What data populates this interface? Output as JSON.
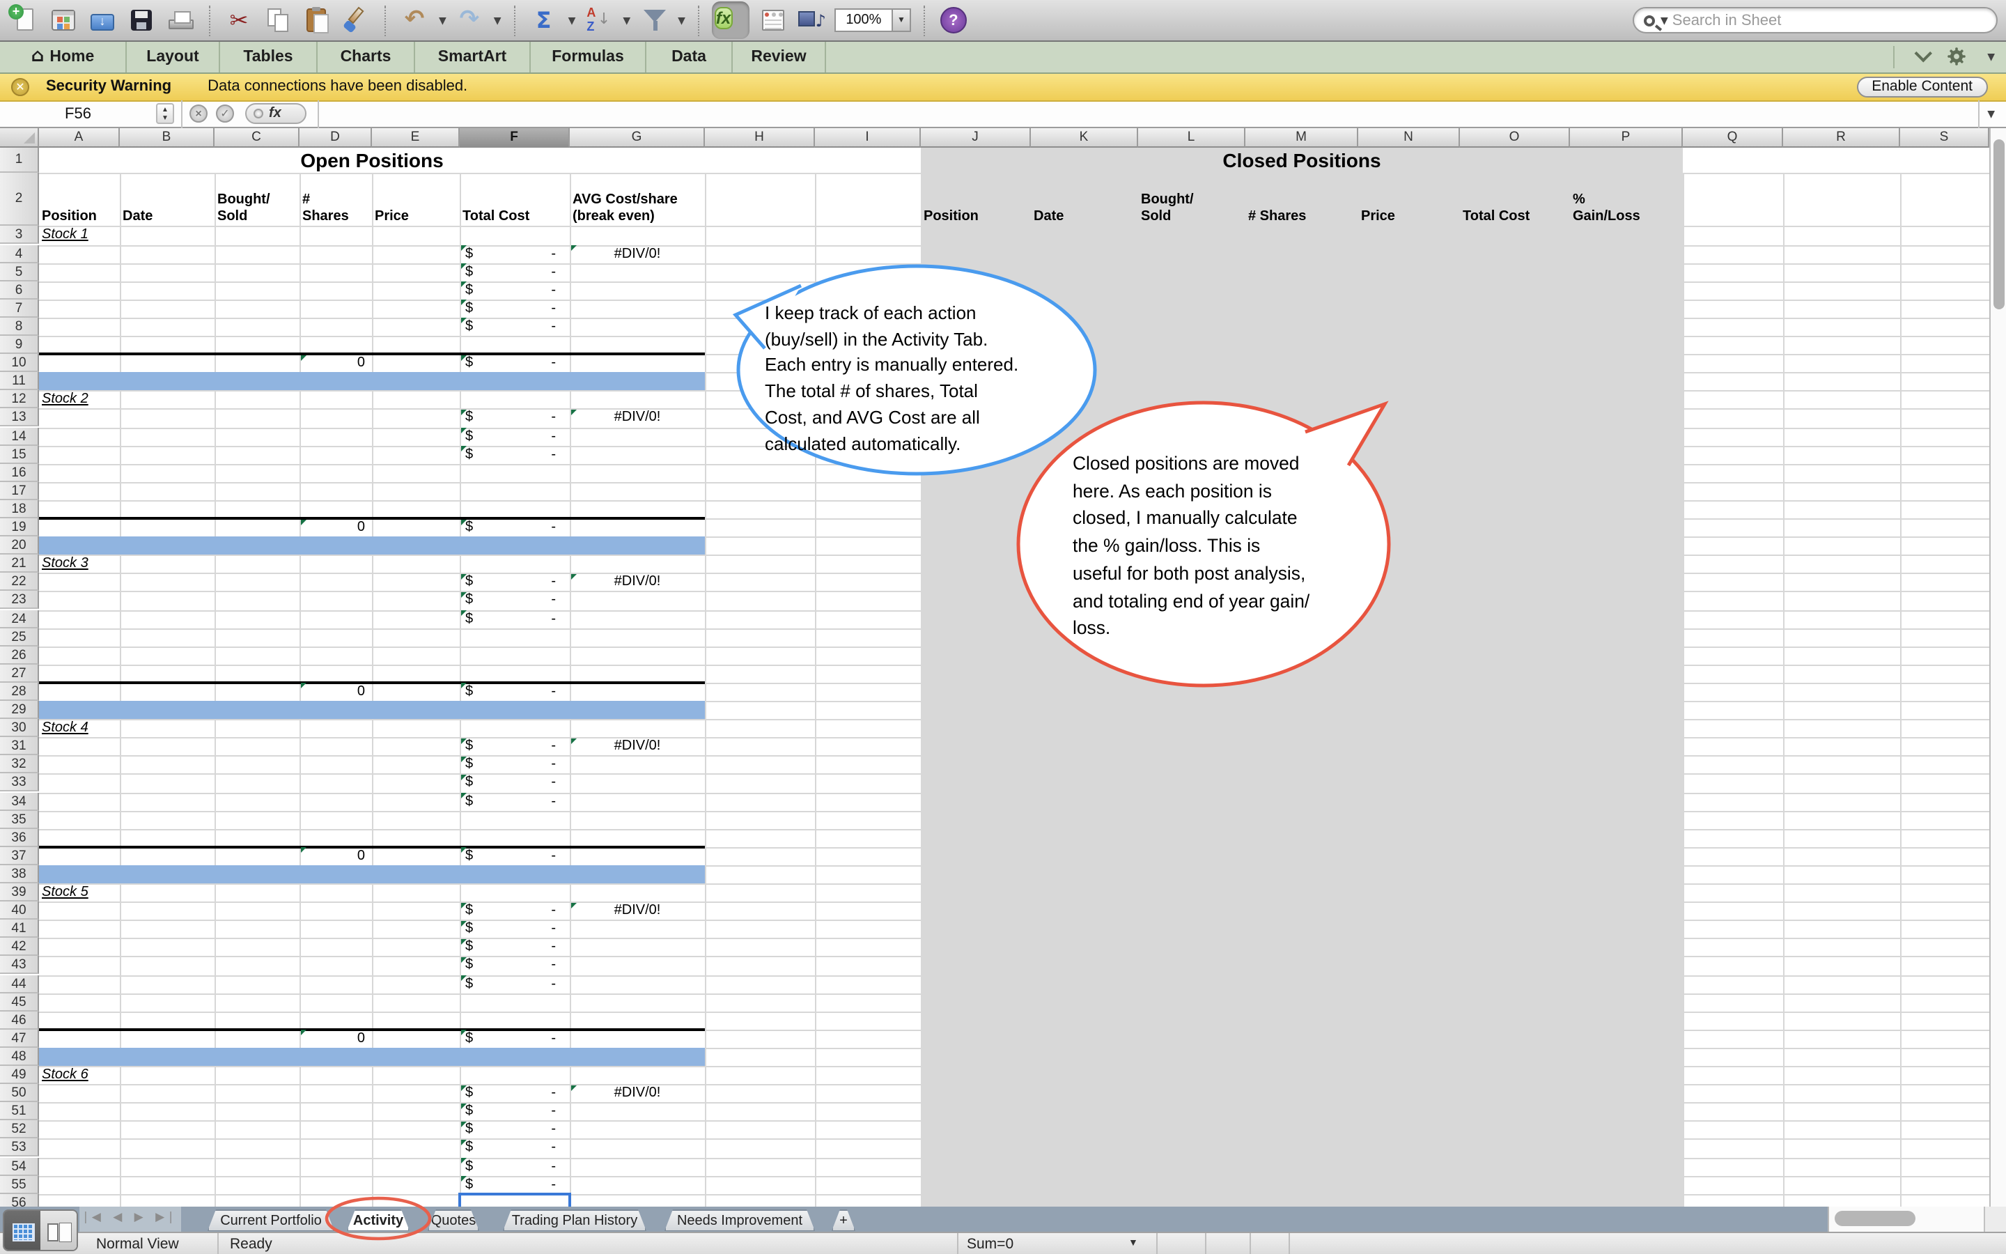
{
  "window": {
    "search_placeholder": "Search in Sheet",
    "zoom_value": "100%"
  },
  "toolbar": {
    "icon_names": [
      "new-document-icon",
      "open-gallery-icon",
      "open-file-icon",
      "save-icon",
      "print-icon",
      "cut-icon",
      "copy-icon",
      "paste-icon",
      "format-painter-icon",
      "undo-icon",
      "redo-icon",
      "autosum-icon",
      "sort-az-icon",
      "filter-icon",
      "formula-builder-icon",
      "toolbox-icon",
      "media-browser-icon",
      "zoom-control",
      "help-icon",
      "search-icon"
    ],
    "fx_label": "fx",
    "help_label": "?",
    "sum_label": "Σ",
    "sort_a": "A",
    "sort_z": "Z",
    "cut_glyph": "✂",
    "undo_glyph": "↶",
    "redo_glyph": "↷",
    "media_glyph": "♪"
  },
  "ribbon": {
    "tabs": [
      {
        "label": "Home",
        "icon": "home-icon"
      },
      {
        "label": "Layout"
      },
      {
        "label": "Tables"
      },
      {
        "label": "Charts"
      },
      {
        "label": "SmartArt"
      },
      {
        "label": "Formulas"
      },
      {
        "label": "Data"
      },
      {
        "label": "Review"
      }
    ],
    "right_icons": [
      "chevron-down-icon",
      "gear-icon"
    ]
  },
  "security_bar": {
    "title": "Security Warning",
    "message": "Data connections have been disabled.",
    "button_label": "Enable Content"
  },
  "formula_bar": {
    "name_box": "F56",
    "cancel_glyph": "×",
    "accept_glyph": "✓",
    "fx_label": "fx"
  },
  "sheet": {
    "columns": [
      "A",
      "B",
      "C",
      "D",
      "E",
      "F",
      "G",
      "H",
      "I",
      "J",
      "K",
      "L",
      "M",
      "N",
      "O",
      "P",
      "Q",
      "R",
      "S"
    ],
    "selected_column": "F",
    "selected_cell": {
      "col": "F",
      "row": 56
    },
    "row_count": 56,
    "open_table": {
      "title": "Open Positions",
      "headers": [
        {
          "col": "A",
          "text": "Position"
        },
        {
          "col": "B",
          "text": "Date"
        },
        {
          "col": "C",
          "text": "Bought/\nSold"
        },
        {
          "col": "D",
          "text": "#\nShares"
        },
        {
          "col": "E",
          "text": "Price"
        },
        {
          "col": "F",
          "text": "Total Cost"
        },
        {
          "col": "G",
          "text": "AVG Cost/share\n(break even)"
        }
      ]
    },
    "closed_table": {
      "title": "Closed Positions",
      "headers": [
        {
          "col": "J",
          "text": "Position"
        },
        {
          "col": "K",
          "text": "Date"
        },
        {
          "col": "L",
          "text": "Bought/\nSold"
        },
        {
          "col": "M",
          "text": "# Shares"
        },
        {
          "col": "N",
          "text": "Price"
        },
        {
          "col": "O",
          "text": "Total Cost"
        },
        {
          "col": "P",
          "text": "%\nGain/Loss"
        }
      ]
    },
    "cells": {
      "currency": "$",
      "dash": "-",
      "zero": "0",
      "div_error": "#DIV/0!"
    },
    "stocks": [
      {
        "label": "Stock 1",
        "label_row": 3,
        "data_start": 4,
        "data_end": 8,
        "total_row": 10,
        "band_row": 11
      },
      {
        "label": "Stock 2",
        "label_row": 12,
        "data_start": 13,
        "data_end": 15,
        "total_row": 19,
        "band_row": 20
      },
      {
        "label": "Stock 3",
        "label_row": 21,
        "data_start": 22,
        "data_end": 24,
        "total_row": 28,
        "band_row": 29
      },
      {
        "label": "Stock 4",
        "label_row": 30,
        "data_start": 31,
        "data_end": 34,
        "total_row": 37,
        "band_row": 38
      },
      {
        "label": "Stock 5",
        "label_row": 39,
        "data_start": 40,
        "data_end": 44,
        "total_row": 47,
        "band_row": 48
      },
      {
        "label": "Stock 6",
        "label_row": 49,
        "data_start": 50,
        "data_end": 55,
        "total_row": null,
        "band_row": null
      }
    ]
  },
  "callouts": {
    "blue": {
      "color": "#4a9bee",
      "text": "I keep track of each action\n(buy/sell) in the Activity Tab.\nEach entry is manually entered.\nThe total # of shares, Total\nCost, and AVG Cost are all\ncalculated automatically."
    },
    "red": {
      "color": "#e8543f",
      "text": "Closed positions are moved\nhere.  As each position is\nclosed, I manually calculate\nthe % gain/loss.  This is\nuseful for both post analysis,\nand totaling end of year gain/\nloss."
    }
  },
  "bottom": {
    "nav_arrows": "|◀ ◀ ▶ ▶|",
    "sheet_tabs": [
      {
        "label": "Current Portfolio",
        "active": false
      },
      {
        "label": "Activity",
        "active": true,
        "circled": true
      },
      {
        "label": "Quotes",
        "active": false
      },
      {
        "label": "Trading Plan History",
        "active": false
      },
      {
        "label": "Needs Improvement",
        "active": false
      }
    ],
    "add_tab_label": "+",
    "status": {
      "view_label": "Normal View",
      "ready_label": "Ready",
      "sum_label": "Sum=0"
    }
  }
}
